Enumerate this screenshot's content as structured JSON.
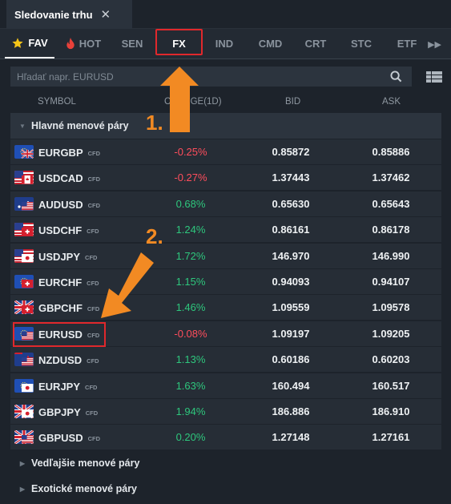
{
  "window": {
    "title": "Sledovanie trhu"
  },
  "tabs": [
    {
      "label": "FAV"
    },
    {
      "label": "HOT"
    },
    {
      "label": "SEN"
    },
    {
      "label": "FX"
    },
    {
      "label": "IND"
    },
    {
      "label": "CMD"
    },
    {
      "label": "CRT"
    },
    {
      "label": "STC"
    },
    {
      "label": "ETF"
    }
  ],
  "search": {
    "placeholder": "Hľadať napr. EURUSD"
  },
  "columns": {
    "symbol": "SYMBOL",
    "change": "CHANGE(1D)",
    "bid": "BID",
    "ask": "ASK"
  },
  "groups": {
    "major": "Hlavné menové páry",
    "minor": "Vedľajšie menové páry",
    "exotic": "Exotické menové páry"
  },
  "cfd_label": "CFD",
  "rows": [
    {
      "symbol": "EURGBP",
      "change": "-0.25%",
      "bid": "0.85872",
      "ask": "0.85886",
      "flags": [
        "eu",
        "gb"
      ]
    },
    {
      "symbol": "USDCAD",
      "change": "-0.27%",
      "bid": "1.37443",
      "ask": "1.37462",
      "flags": [
        "us",
        "ca"
      ]
    },
    {
      "symbol": "AUDUSD",
      "change": "0.68%",
      "bid": "0.65630",
      "ask": "0.65643",
      "flags": [
        "au",
        "us"
      ]
    },
    {
      "symbol": "USDCHF",
      "change": "1.24%",
      "bid": "0.86161",
      "ask": "0.86178",
      "flags": [
        "us",
        "ch"
      ]
    },
    {
      "symbol": "USDJPY",
      "change": "1.72%",
      "bid": "146.970",
      "ask": "146.990",
      "flags": [
        "us",
        "jp"
      ]
    },
    {
      "symbol": "EURCHF",
      "change": "1.15%",
      "bid": "0.94093",
      "ask": "0.94107",
      "flags": [
        "eu",
        "ch"
      ]
    },
    {
      "symbol": "GBPCHF",
      "change": "1.46%",
      "bid": "1.09559",
      "ask": "1.09578",
      "flags": [
        "gb",
        "ch"
      ]
    },
    {
      "symbol": "EURUSD",
      "change": "-0.08%",
      "bid": "1.09197",
      "ask": "1.09205",
      "flags": [
        "eu",
        "us"
      ]
    },
    {
      "symbol": "NZDUSD",
      "change": "1.13%",
      "bid": "0.60186",
      "ask": "0.60203",
      "flags": [
        "nz",
        "us"
      ]
    },
    {
      "symbol": "EURJPY",
      "change": "1.63%",
      "bid": "160.494",
      "ask": "160.517",
      "flags": [
        "eu",
        "jp"
      ]
    },
    {
      "symbol": "GBPJPY",
      "change": "1.94%",
      "bid": "186.886",
      "ask": "186.910",
      "flags": [
        "gb",
        "jp"
      ]
    },
    {
      "symbol": "GBPUSD",
      "change": "0.20%",
      "bid": "1.27148",
      "ask": "1.27161",
      "flags": [
        "gb",
        "us"
      ]
    }
  ],
  "annotations": {
    "step1": "1.",
    "step2": "2."
  },
  "colors": {
    "negative": "#ff4d5c",
    "positive": "#2ec77d",
    "highlight": "#e0282c",
    "arrow": "#f28a23"
  }
}
